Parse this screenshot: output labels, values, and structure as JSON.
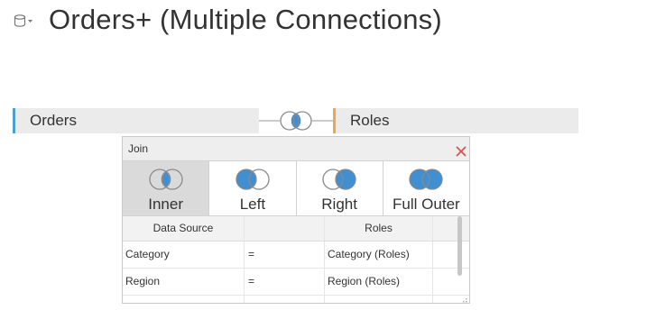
{
  "datasource": {
    "icon": "database-icon",
    "title": "Orders+ (Multiple Connections)"
  },
  "canvas": {
    "left_table": "Orders",
    "right_table": "Roles",
    "join_connector_icon": "inner-join-icon",
    "colors": {
      "left_accent": "#4e9ecf",
      "right_accent": "#f0a64a",
      "join_fill": "#3f8fd2"
    }
  },
  "join_dialog": {
    "title": "Join",
    "close_icon": "close-icon",
    "join_types": [
      {
        "label": "Inner",
        "icon": "inner-join-icon",
        "selected": true
      },
      {
        "label": "Left",
        "icon": "left-join-icon",
        "selected": false
      },
      {
        "label": "Right",
        "icon": "right-join-icon",
        "selected": false
      },
      {
        "label": "Full Outer",
        "icon": "full-outer-join-icon",
        "selected": false
      }
    ],
    "clauses": {
      "headers": {
        "left": "Data Source",
        "operator": "",
        "right": "Roles"
      },
      "rows": [
        {
          "left": "Category",
          "operator": "=",
          "right": "Category (Roles)"
        },
        {
          "left": "Region",
          "operator": "=",
          "right": "Region (Roles)"
        }
      ]
    }
  }
}
